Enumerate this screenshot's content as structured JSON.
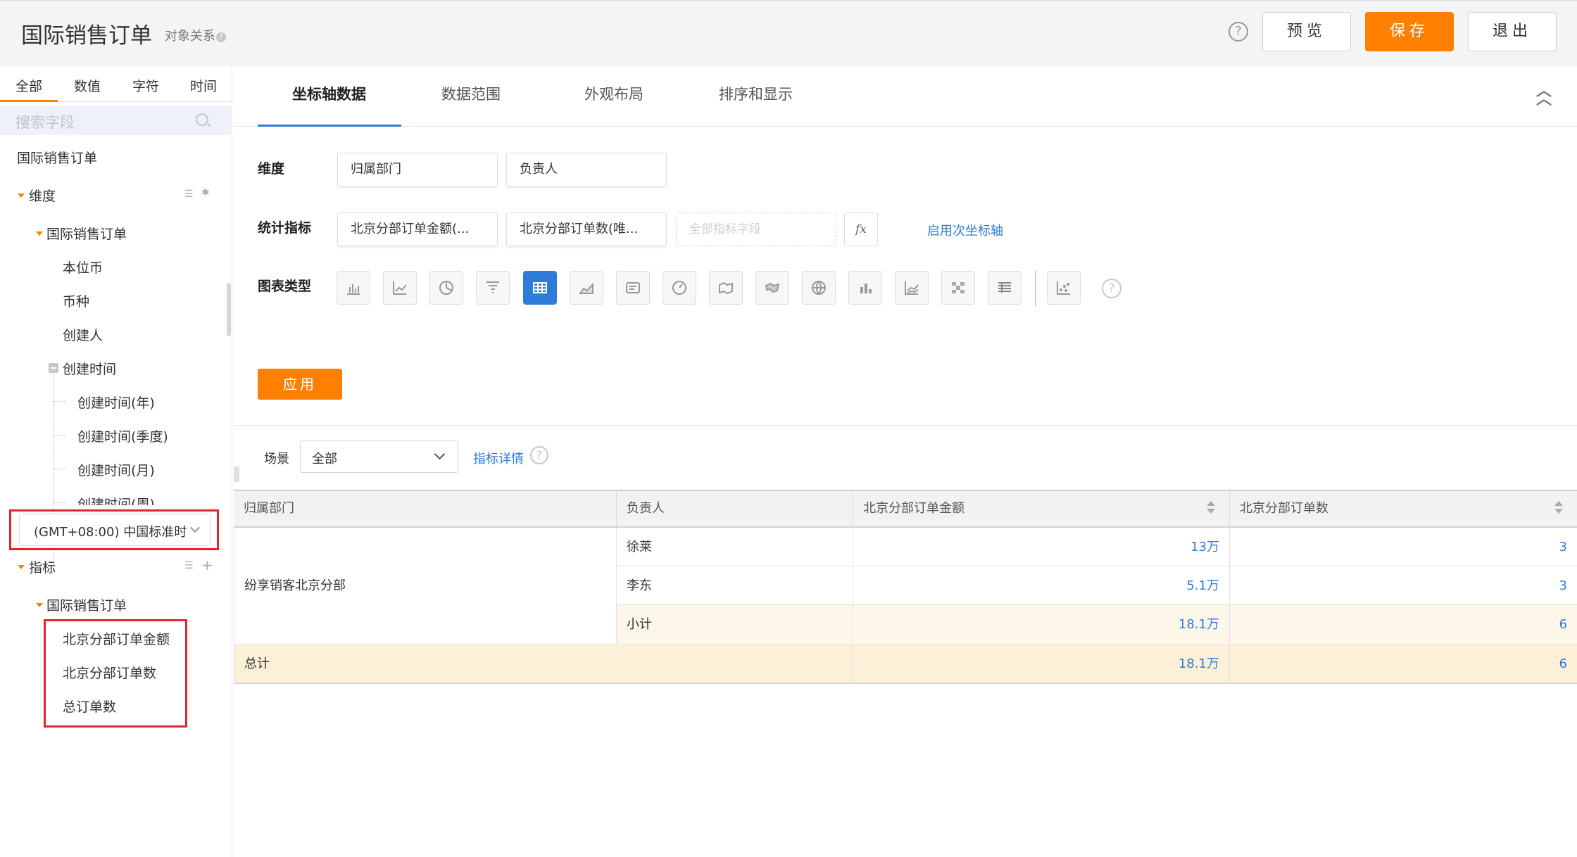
{
  "header": {
    "title": "国际销售订单",
    "object_relation": "对象关系",
    "help_glyph": "?",
    "preview_label": "预览",
    "save_label": "保存",
    "exit_label": "退出"
  },
  "field_panel": {
    "tabs": [
      "全部",
      "数值",
      "字符",
      "时间"
    ],
    "active_tab": "全部",
    "search_placeholder": "搜索字段",
    "root_label": "国际销售订单",
    "dimension_label": "维度",
    "dimension_group": "国际销售订单",
    "dimension_items": [
      "本位币",
      "币种",
      "创建人"
    ],
    "created_time_label": "创建时间",
    "created_time_children": [
      "创建时间(年)",
      "创建时间(季度)",
      "创建时间(月)",
      "创建时间(周)"
    ],
    "timezone": "(GMT+08:00) 中国标准时",
    "metric_label": "指标",
    "metric_group": "国际销售订单",
    "metric_items": [
      "北京分部订单金额",
      "北京分部订单数",
      "总订单数"
    ]
  },
  "config_tabs": [
    "坐标轴数据",
    "数据范围",
    "外观布局",
    "排序和显示"
  ],
  "active_config_tab": "坐标轴数据",
  "config": {
    "dimension_label": "维度",
    "dimension_fields": [
      "归属部门",
      "负责人"
    ],
    "metric_label": "统计指标",
    "metric_fields": [
      "北京分部订单金额(...",
      "北京分部订单数(唯..."
    ],
    "metric_placeholder": "全部指标字段",
    "fx_label": "fx",
    "secondary_axis": "启用次坐标轴",
    "chart_type_label": "图表类型",
    "chart_types": [
      "bar-chart-icon",
      "line-chart-icon",
      "pie-chart-icon",
      "funnel-chart-icon",
      "table-icon",
      "area-chart-icon",
      "card-icon",
      "gauge-icon",
      "map-icon",
      "world-map-icon",
      "globe-icon",
      "stacked-bar-icon",
      "dual-line-icon",
      "heatmap-icon",
      "pivot-table-icon",
      "scatter-icon"
    ],
    "selected_chart_type": "table-icon",
    "apply_label": "应用"
  },
  "filter": {
    "scene_label": "场景",
    "scene_value": "全部",
    "metric_detail": "指标详情"
  },
  "table": {
    "columns": [
      "归属部门",
      "负责人",
      "北京分部订单金额",
      "北京分部订单数"
    ],
    "group": "纷享销客北京分部",
    "rows": [
      {
        "owner": "徐莱",
        "amount": "13万",
        "count": "3"
      },
      {
        "owner": "李东",
        "amount": "5.1万",
        "count": "3"
      }
    ],
    "subtotal": {
      "label": "小计",
      "amount": "18.1万",
      "count": "6"
    },
    "total": {
      "label": "总计",
      "amount": "18.1万",
      "count": "6"
    }
  },
  "colors": {
    "accent_orange": "#ff7f00",
    "accent_blue": "#2f7bd8",
    "highlight_red": "#e0262d"
  }
}
